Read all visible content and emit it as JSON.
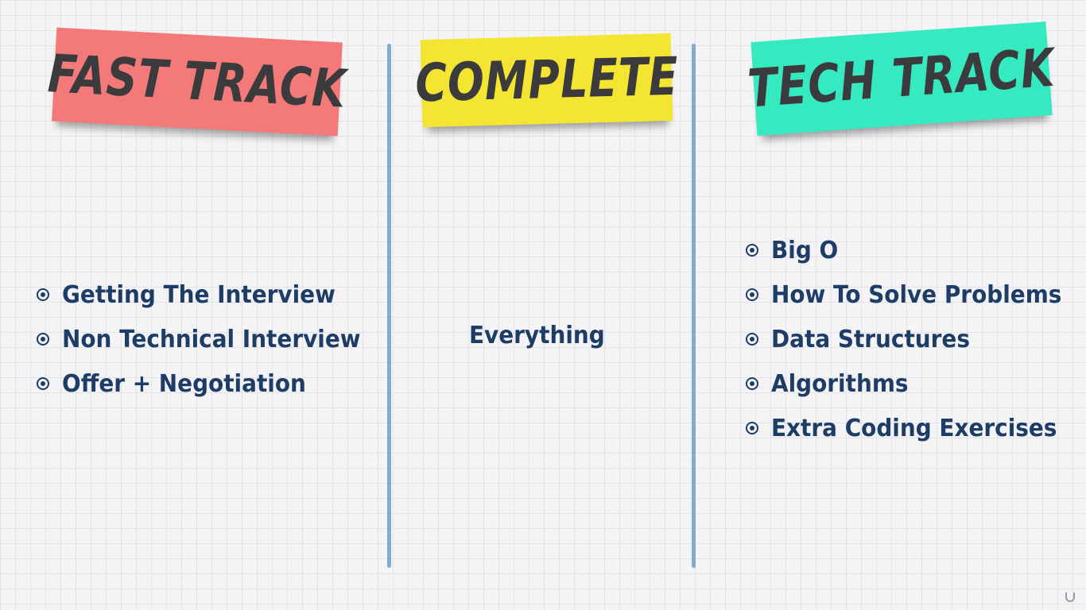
{
  "labels": {
    "fast_track": {
      "text": "FAST TRACK",
      "color": "#f47a7a"
    },
    "complete": {
      "text": "COMPLETE",
      "color": "#f5e533"
    },
    "tech_track": {
      "text": "TECH TRACK",
      "color": "#35eac0"
    }
  },
  "fast_track_items": [
    "Getting The Interview",
    "Non Technical Interview",
    "Offer + Negotiation"
  ],
  "complete_text": "Everything",
  "tech_track_items": [
    "Big O",
    "How To Solve Problems",
    "Data Structures",
    "Algorithms",
    "Extra Coding Exercises"
  ],
  "colors": {
    "text": "#1e3d66",
    "divider": "#77a3cc",
    "label_text": "#3b3b3d"
  },
  "watermark": {
    "logo_icon": "udemy-logo-icon"
  }
}
